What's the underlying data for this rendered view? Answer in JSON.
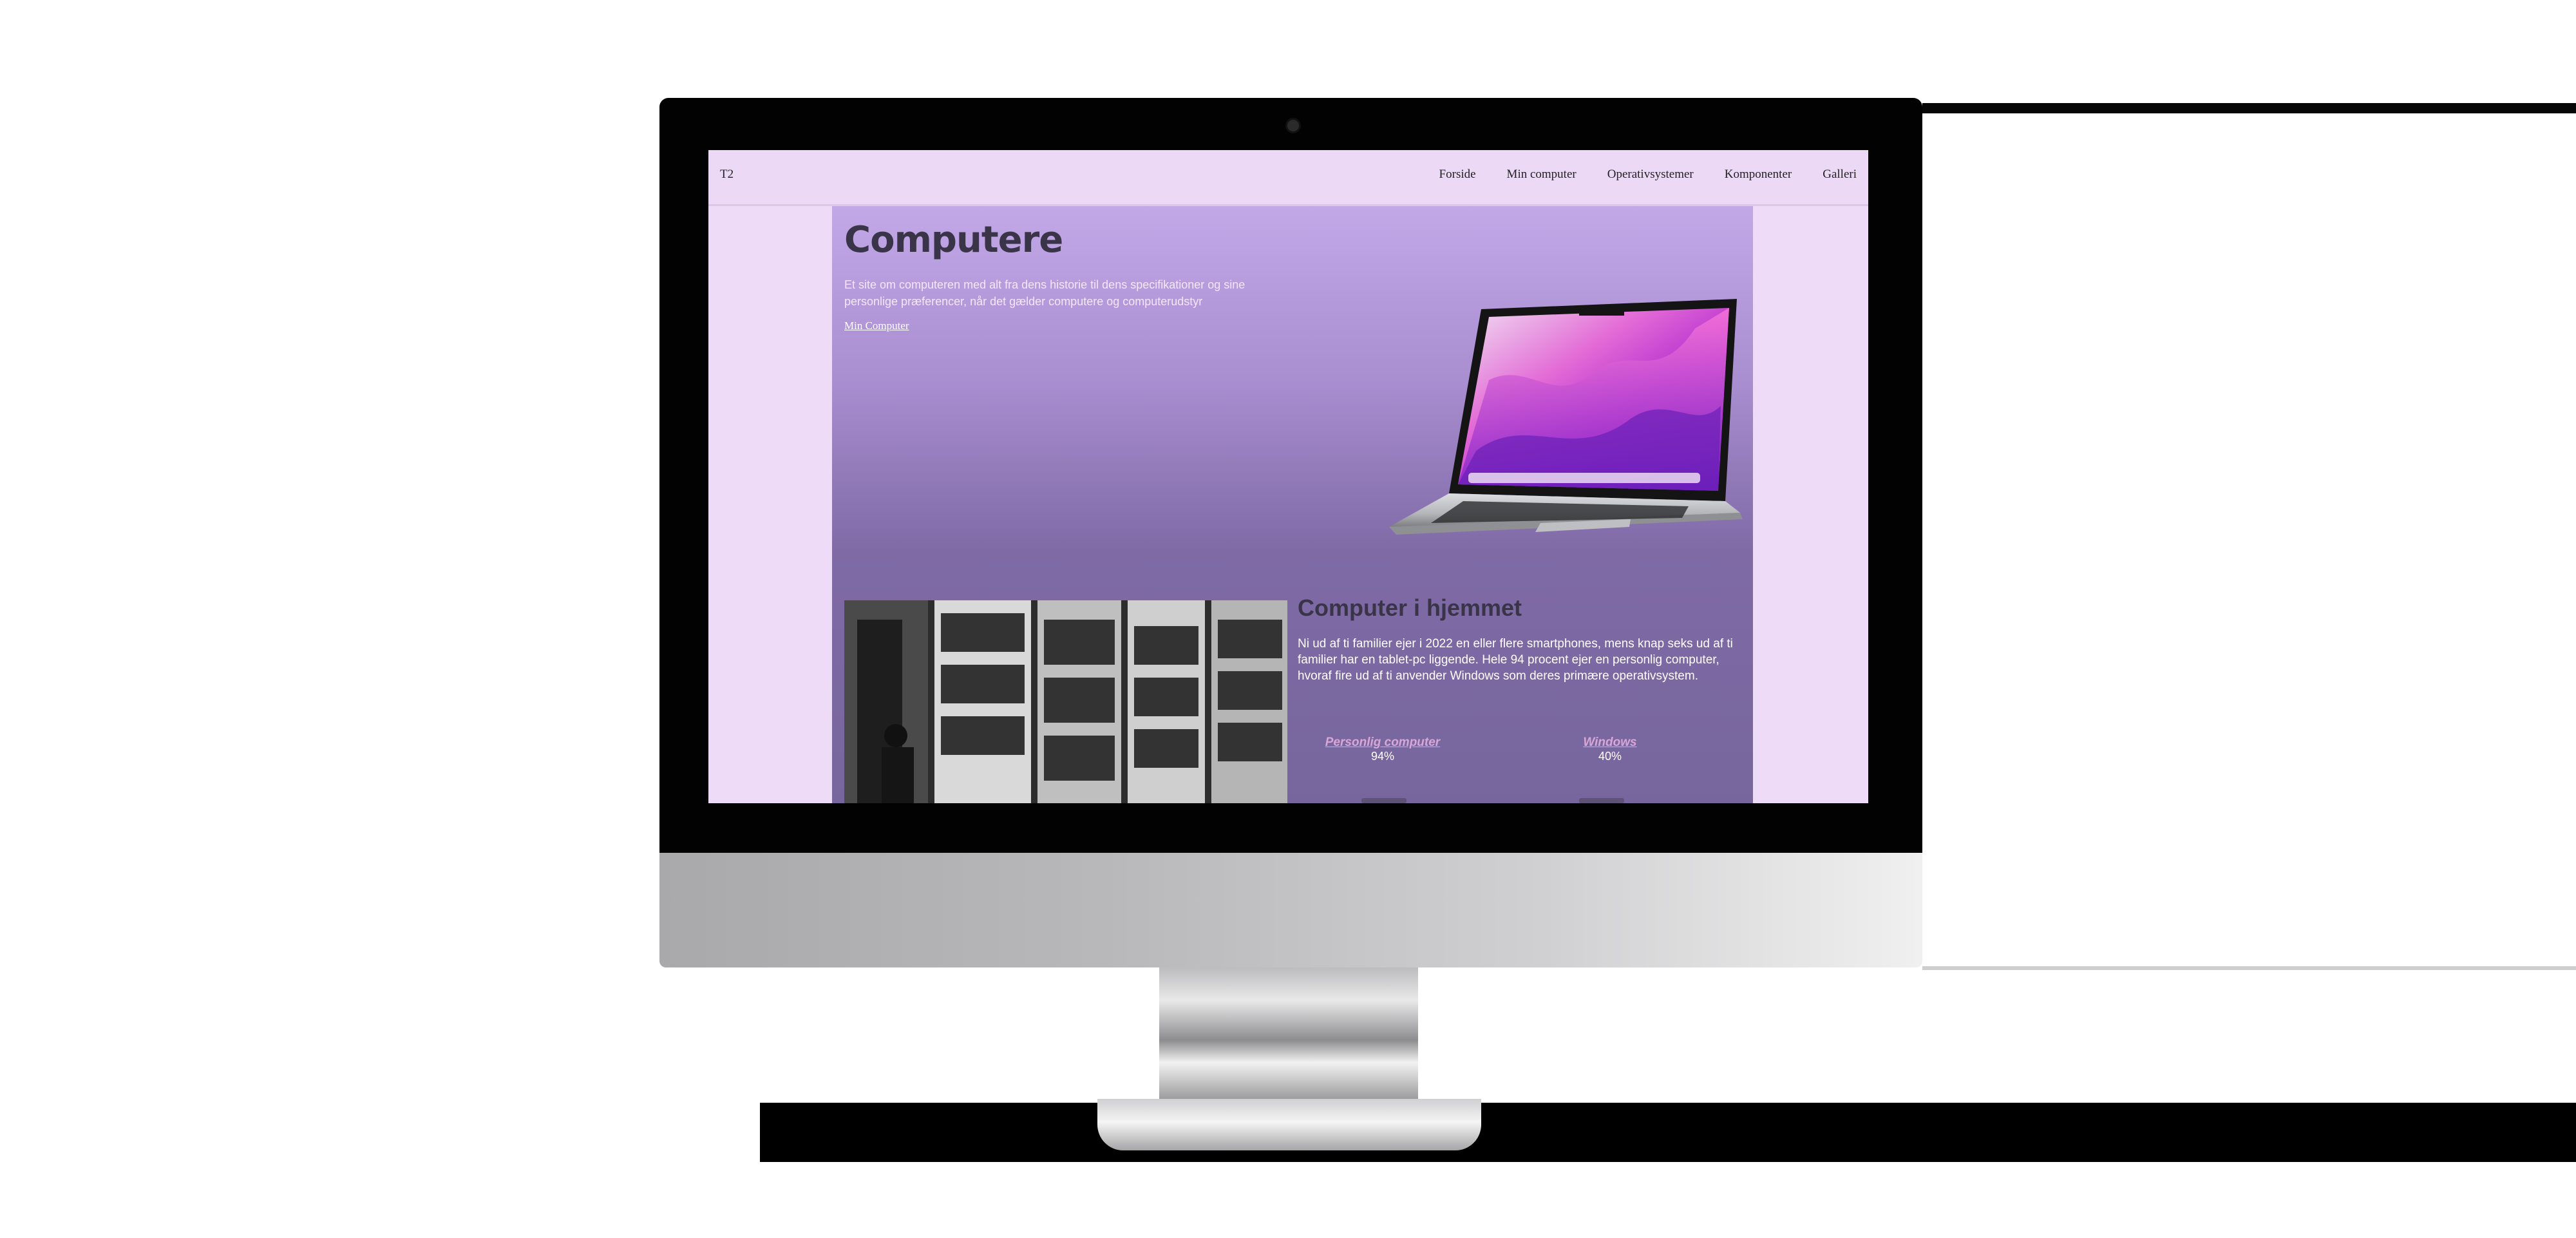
{
  "site": {
    "brand": "T2",
    "nav": [
      "Forside",
      "Min computer",
      "Operativsystemer",
      "Komponenter",
      "Galleri"
    ]
  },
  "hero": {
    "title": "Computere",
    "subtitle": "Et site om computeren med alt fra dens historie til dens specifikationer og sine personlige præferencer, når det gælder computere og computerudstyr",
    "link": "Min Computer"
  },
  "section": {
    "title": "Computer i hjemmet",
    "text": "Ni ud af ti familier ejer i 2022 en eller flere smartphones, mens knap seks ud af ti familier har en tablet-pc liggende. Hele 94 procent ejer en personlig computer, hvoraf fire ud af ti anvender Windows som deres primære operativsystem.",
    "stats": [
      {
        "label": "Personlig computer",
        "value": "94%"
      },
      {
        "label": "Windows",
        "value": "40%"
      }
    ]
  },
  "colors": {
    "nav_bg": "#ecd9f6",
    "content_top": "#c3a8e8",
    "content_bottom": "#77669d",
    "title": "#3a3448",
    "stat_label": "#d9a6d8"
  }
}
